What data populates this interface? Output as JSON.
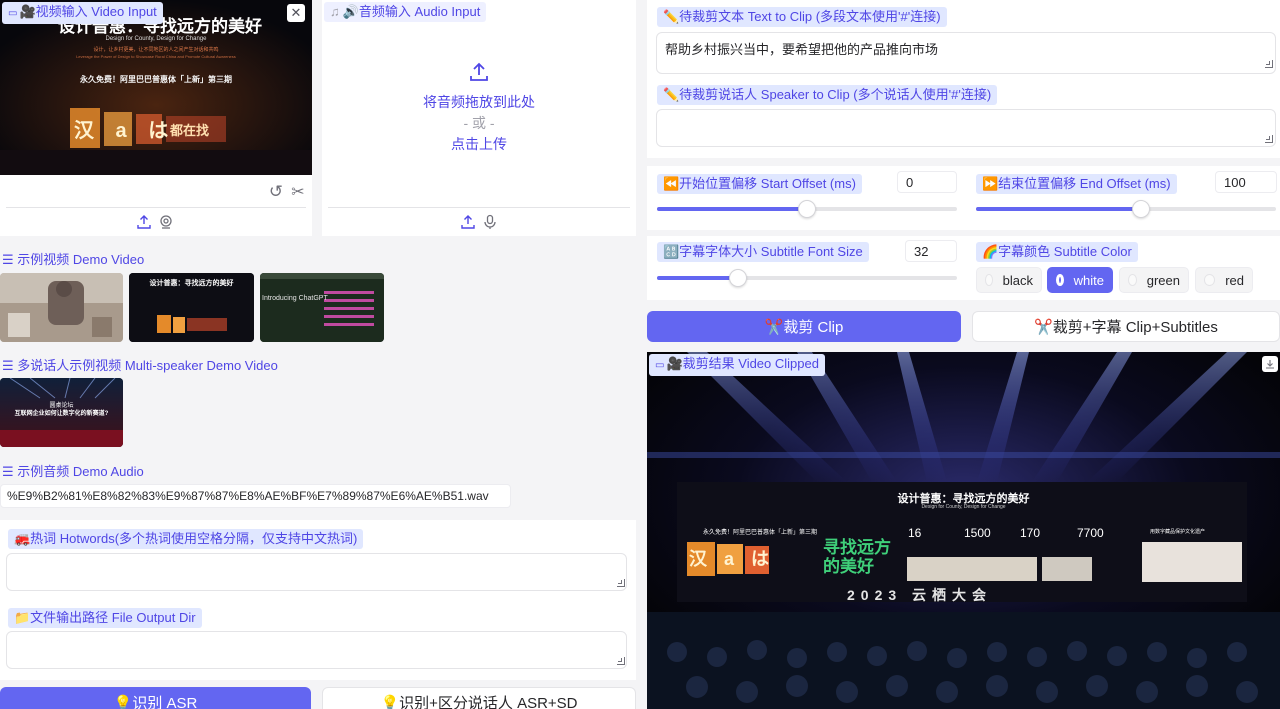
{
  "video_input": {
    "label": "🎥视频输入 Video Input",
    "slide_title": "设计普惠：寻找远方的美好",
    "slide_subtitle_en": "Design for County, Design for Change",
    "slide_line_cn": "设计，让乡村更美，让不同地区的人之间产生对话和共鸣",
    "slide_line_en": "Leverage the Power of Design to Showcase Rural China and Promote Cultural Awareness",
    "slide_event": "永久免费！阿里巴巴普惠体「上新」第三期",
    "slide_chars": "汉 a は",
    "slide_chars_2": "都在找"
  },
  "audio_input": {
    "label": "🔊音频输入 Audio Input",
    "drop_text": "将音频拖放到此处",
    "or_text": "- 或 -",
    "upload_text": "点击上传"
  },
  "demo_video": {
    "title": "☰ 示例视频 Demo Video",
    "thumb2_title": "设计普惠：寻找远方的美好",
    "thumb3_title": "Introducing ChatGPT"
  },
  "multi_demo": {
    "title": "☰ 多说话人示例视频 Multi-speaker Demo Video",
    "thumb_line1": "圆桌论坛",
    "thumb_line2": "互联网企业如何让数字化的新赛道?"
  },
  "demo_audio": {
    "title": "☰ 示例音频 Demo Audio",
    "file": "%E9%B2%81%E8%82%83%E9%87%87%E8%AE%BF%E7%89%87%E6%AE%B51.wav"
  },
  "hotwords": {
    "label": "🚒热词 Hotwords(多个热词使用空格分隔，仅支持中文热词)",
    "value": ""
  },
  "output_dir": {
    "label": "📁文件输出路径 File Output Dir",
    "value": ""
  },
  "buttons": {
    "asr": "💡识别 ASR",
    "asr_sd": "💡识别+区分说话人 ASR+SD",
    "clip": "✂️裁剪 Clip",
    "clip_subtitles": "✂️裁剪+字幕 Clip+Subtitles"
  },
  "clip_text": {
    "label": "✏️待裁剪文本 Text to Clip (多段文本使用'#'连接)",
    "value": "帮助乡村振兴当中，要希望把他的产品推向市场"
  },
  "clip_speaker": {
    "label": "✏️待裁剪说话人 Speaker to Clip (多个说话人使用'#'连接)",
    "value": ""
  },
  "start_offset": {
    "label": "⏪开始位置偏移 Start Offset (ms)",
    "value": "0",
    "fraction": 0.5
  },
  "end_offset": {
    "label": "⏩结束位置偏移 End Offset (ms)",
    "value": "100",
    "fraction": 0.55
  },
  "font_size": {
    "label": "🔠字幕字体大小 Subtitle Font Size",
    "value": "32",
    "fraction": 0.27
  },
  "subtitle_color": {
    "label": "🌈字幕颜色 Subtitle Color",
    "options": [
      "black",
      "white",
      "green",
      "red"
    ],
    "selected": "white"
  },
  "video_clipped": {
    "label": "🎥裁剪结果 Video Clipped",
    "stage_title": "设计普惠：寻找远方的美好",
    "stage_sub": "Design for County, Design for Change",
    "stage_event": "永久免费！阿里巴巴普惠体「上新」第三期",
    "stage_chars": "汉 a は",
    "stage_green": "寻找远方的美好",
    "stat1": "16",
    "stat2": "1500",
    "stat3": "170",
    "stat4": "7700",
    "stage_right": "用数字藏品保护文化遗产",
    "stage_bottom": "2023 云栖大会"
  },
  "colors": {
    "accent": "#6366f1",
    "chip_bg": "#e0e7ff",
    "chip_text": "#4f46e5"
  }
}
